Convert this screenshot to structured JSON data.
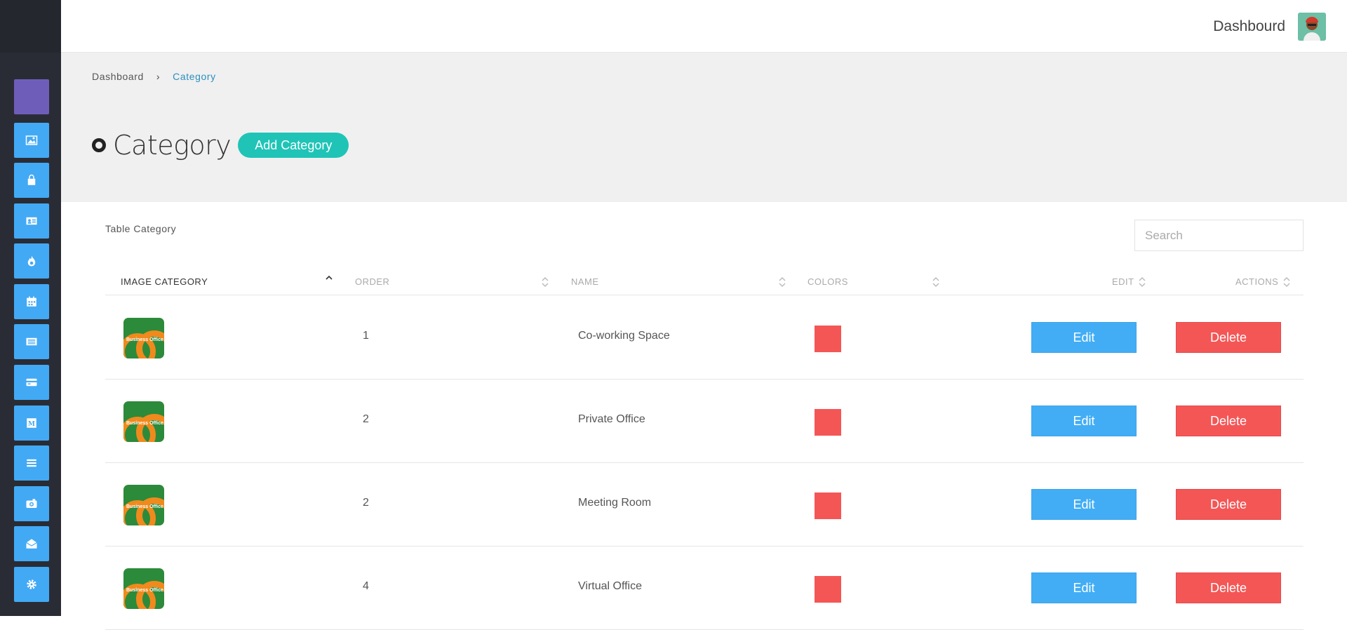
{
  "sidebar": {
    "items": [
      {
        "icon": "square-icon",
        "active": true
      },
      {
        "icon": "image-icon"
      },
      {
        "icon": "shopping-bag-icon"
      },
      {
        "icon": "id-card-icon"
      },
      {
        "icon": "fire-icon"
      },
      {
        "icon": "calendar-icon"
      },
      {
        "icon": "newspaper-icon"
      },
      {
        "icon": "credit-card-icon"
      },
      {
        "icon": "medium-icon"
      },
      {
        "icon": "list-icon"
      },
      {
        "icon": "camera-icon"
      },
      {
        "icon": "envelope-open-icon"
      },
      {
        "icon": "gear-icon"
      }
    ]
  },
  "topbar": {
    "title": "Dashbourd"
  },
  "breadcrumb": {
    "home": "Dashboard",
    "current": "Category"
  },
  "page": {
    "title": "Category",
    "add_button": "Add Category"
  },
  "table": {
    "caption": "Table Category",
    "search_placeholder": "Search",
    "columns": [
      "IMAGE CATEGORY",
      "ORDER",
      "NAME",
      "COLORS",
      "EDIT",
      "ACTIONS"
    ],
    "rows": [
      {
        "order": "1",
        "name": "Co-working Space",
        "color": "#f45656",
        "edit": "Edit",
        "delete": "Delete"
      },
      {
        "order": "2",
        "name": "Private Office",
        "color": "#f45656",
        "edit": "Edit",
        "delete": "Delete"
      },
      {
        "order": "2",
        "name": "Meeting Room",
        "color": "#f45656",
        "edit": "Edit",
        "delete": "Delete"
      },
      {
        "order": "4",
        "name": "Virtual Office",
        "color": "#f45656",
        "edit": "Edit",
        "delete": "Delete"
      }
    ],
    "image_logo_text": "Business Office"
  },
  "colors": {
    "accent": "#42a9f5",
    "teal": "#1fc4b7",
    "danger": "#f45656",
    "sidebar": "#2a2c35"
  }
}
